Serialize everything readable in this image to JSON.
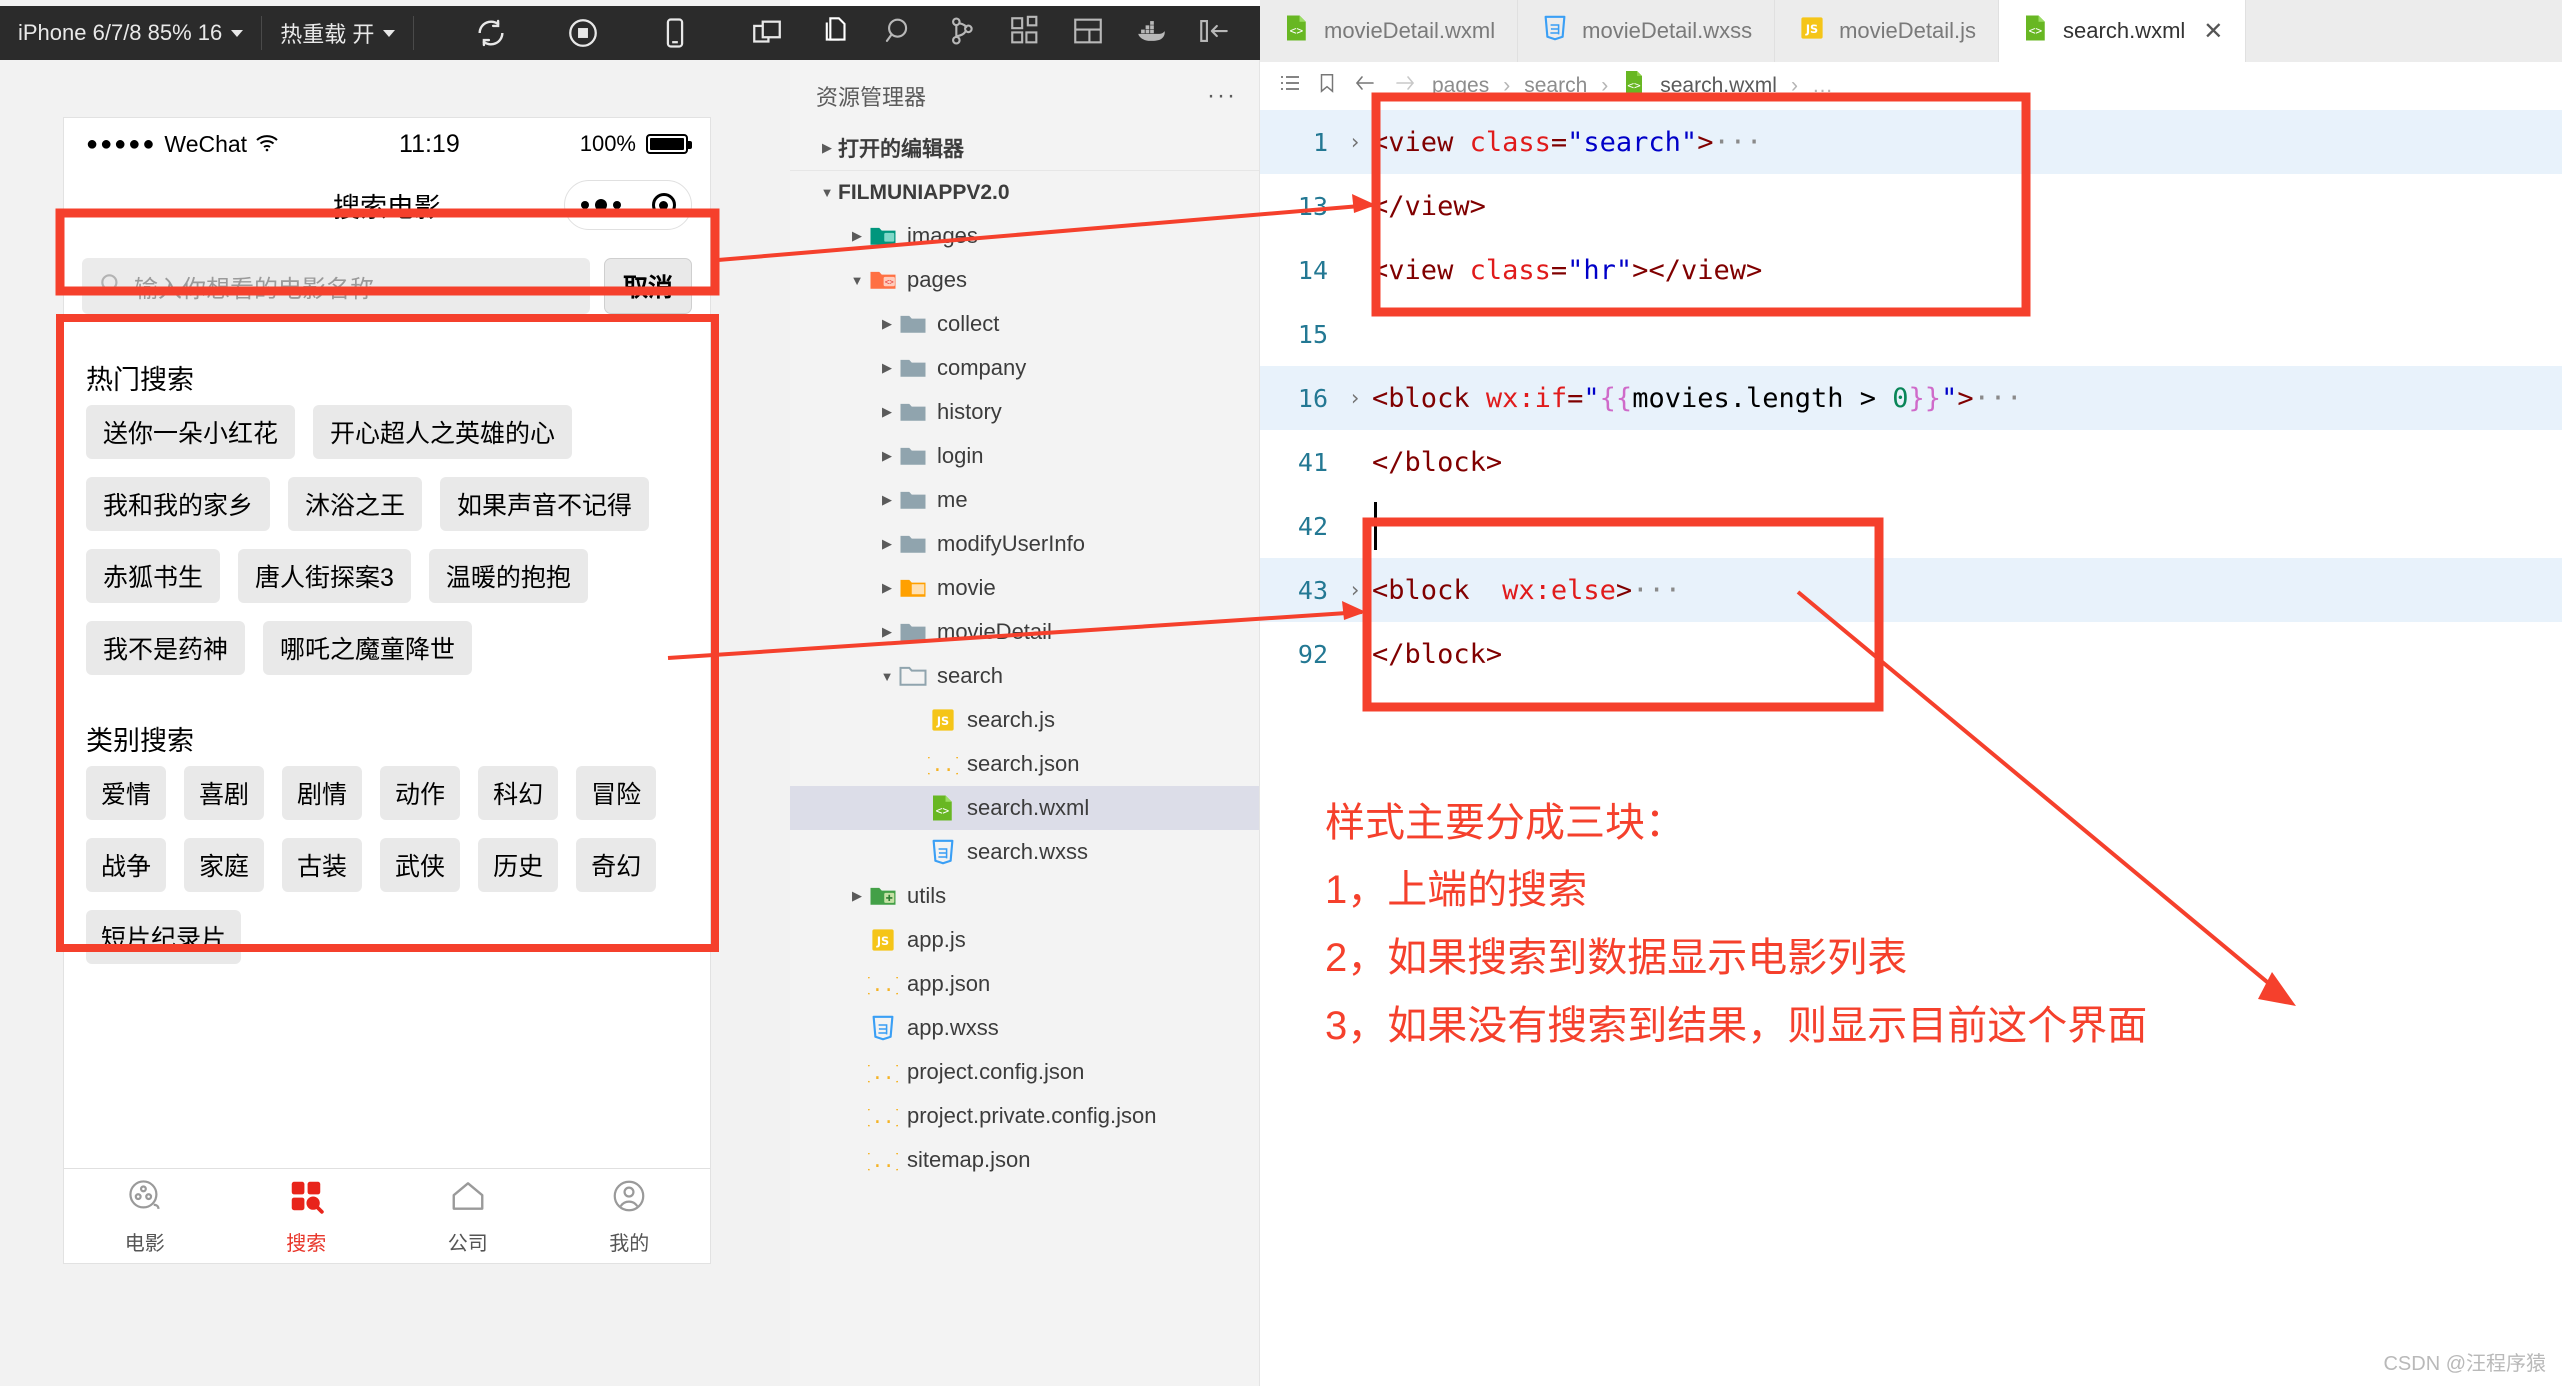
{
  "simulator": {
    "device_select": "iPhone 6/7/8 85% 16",
    "hotreload_select": "热重载 开",
    "toolbar_icons": [
      "refresh-icon",
      "stop-record-icon",
      "phone-icon",
      "multi-window-icon"
    ],
    "phone": {
      "status_bar": {
        "carrier": "WeChat",
        "signal": "●●●●●",
        "time": "11:19",
        "battery_pct": "100%"
      },
      "nav_title": "搜索电影",
      "search": {
        "placeholder": "输入你想看的电影名称",
        "value": "",
        "cancel_label": "取消"
      },
      "hot_section_title": "热门搜索",
      "hot_tags": [
        [
          "送你一朵小红花",
          "开心超人之英雄的心"
        ],
        [
          "我和我的家乡",
          "沐浴之王",
          "如果声音不记得"
        ],
        [
          "赤狐书生",
          "唐人街探案3",
          "温暖的抱抱"
        ],
        [
          "我不是药神",
          "哪吒之魔童降世"
        ]
      ],
      "category_section_title": "类别搜索",
      "category_tags": [
        [
          "爱情",
          "喜剧",
          "剧情",
          "动作",
          "科幻",
          "冒险"
        ],
        [
          "战争",
          "家庭",
          "古装",
          "武侠",
          "历史",
          "奇幻"
        ],
        [
          "短片纪录片"
        ]
      ],
      "tabbar": [
        {
          "label": "电影",
          "icon": "film-reel-icon",
          "active": false
        },
        {
          "label": "搜索",
          "icon": "search-grid-icon",
          "active": true
        },
        {
          "label": "公司",
          "icon": "home-icon",
          "active": false
        },
        {
          "label": "我的",
          "icon": "user-icon",
          "active": false
        }
      ]
    }
  },
  "ide_sidebar": {
    "icons": [
      "files-icon",
      "search-icon",
      "source-control-icon",
      "extensions-icon",
      "layout-icon",
      "docker-icon",
      "collapse-panel-icon"
    ]
  },
  "explorer": {
    "title": "资源管理器",
    "more_label": "···",
    "open_editors_label": "打开的编辑器",
    "project_label": "FILMUNIAPPV2.0",
    "tree": [
      {
        "label": "images",
        "type": "folder",
        "icon": "folder-images-icon",
        "depth": 1,
        "expanded": false,
        "selected": false
      },
      {
        "label": "pages",
        "type": "folder",
        "icon": "folder-pages-icon",
        "depth": 1,
        "expanded": true,
        "selected": false
      },
      {
        "label": "collect",
        "type": "folder",
        "icon": "folder-icon",
        "depth": 2,
        "expanded": false,
        "selected": false
      },
      {
        "label": "company",
        "type": "folder",
        "icon": "folder-icon",
        "depth": 2,
        "expanded": false,
        "selected": false
      },
      {
        "label": "history",
        "type": "folder",
        "icon": "folder-icon",
        "depth": 2,
        "expanded": false,
        "selected": false
      },
      {
        "label": "login",
        "type": "folder",
        "icon": "folder-icon",
        "depth": 2,
        "expanded": false,
        "selected": false
      },
      {
        "label": "me",
        "type": "folder",
        "icon": "folder-icon",
        "depth": 2,
        "expanded": false,
        "selected": false
      },
      {
        "label": "modifyUserInfo",
        "type": "folder",
        "icon": "folder-icon",
        "depth": 2,
        "expanded": false,
        "selected": false
      },
      {
        "label": "movie",
        "type": "folder",
        "icon": "folder-movie-icon",
        "depth": 2,
        "expanded": false,
        "selected": false
      },
      {
        "label": "movieDetail",
        "type": "folder",
        "icon": "folder-icon",
        "depth": 2,
        "expanded": false,
        "selected": false
      },
      {
        "label": "search",
        "type": "folder",
        "icon": "folder-open-icon",
        "depth": 2,
        "expanded": true,
        "selected": false
      },
      {
        "label": "search.js",
        "type": "file",
        "icon": "js-file-icon",
        "depth": 3,
        "selected": false
      },
      {
        "label": "search.json",
        "type": "file",
        "icon": "json-file-icon",
        "depth": 3,
        "selected": false
      },
      {
        "label": "search.wxml",
        "type": "file",
        "icon": "wxml-file-icon",
        "depth": 3,
        "selected": true
      },
      {
        "label": "search.wxss",
        "type": "file",
        "icon": "wxss-file-icon",
        "depth": 3,
        "selected": false
      },
      {
        "label": "utils",
        "type": "folder",
        "icon": "folder-utils-icon",
        "depth": 1,
        "expanded": false,
        "selected": false
      },
      {
        "label": "app.js",
        "type": "file",
        "icon": "js-file-icon",
        "depth": 1,
        "selected": false
      },
      {
        "label": "app.json",
        "type": "file",
        "icon": "json-file-icon",
        "depth": 1,
        "selected": false
      },
      {
        "label": "app.wxss",
        "type": "file",
        "icon": "wxss-file-icon",
        "depth": 1,
        "selected": false
      },
      {
        "label": "project.config.json",
        "type": "file",
        "icon": "json-file-icon",
        "depth": 1,
        "selected": false
      },
      {
        "label": "project.private.config.json",
        "type": "file",
        "icon": "json-file-icon",
        "depth": 1,
        "selected": false
      },
      {
        "label": "sitemap.json",
        "type": "file",
        "icon": "json-file-icon",
        "depth": 1,
        "selected": false
      }
    ]
  },
  "editor": {
    "tabs": [
      {
        "label": "movieDetail.wxml",
        "icon": "wxml-file-icon",
        "active": false,
        "closable": false
      },
      {
        "label": "movieDetail.wxss",
        "icon": "wxss-file-icon",
        "active": false,
        "closable": false
      },
      {
        "label": "movieDetail.js",
        "icon": "js-file-icon",
        "active": false,
        "closable": false
      },
      {
        "label": "search.wxml",
        "icon": "wxml-file-icon",
        "active": true,
        "closable": true,
        "close_label": "✕"
      }
    ],
    "breadcrumb": {
      "list_icon": "outline-icon",
      "bookmark_icon": "bookmark-icon",
      "back_icon": "arrow-left-icon",
      "forward_icon": "arrow-right-icon",
      "items": [
        "pages",
        "search",
        "search.wxml"
      ],
      "trailing": "…",
      "separator": "›"
    },
    "lines": [
      {
        "num": "1",
        "fold": "›",
        "highlight": true,
        "code": "<view class=\"search\">···"
      },
      {
        "num": "13",
        "fold": "",
        "highlight": false,
        "code": "</view>"
      },
      {
        "num": "14",
        "fold": "",
        "highlight": false,
        "code": "<view class=\"hr\"></view>"
      },
      {
        "num": "15",
        "fold": "",
        "highlight": false,
        "code": ""
      },
      {
        "num": "16",
        "fold": "›",
        "highlight": true,
        "code": "<block wx:if=\"{{movies.length > 0}}\">···"
      },
      {
        "num": "41",
        "fold": "",
        "highlight": false,
        "code": "</block>"
      },
      {
        "num": "42",
        "fold": "",
        "highlight": false,
        "code": ""
      },
      {
        "num": "43",
        "fold": "›",
        "highlight": true,
        "code": "<block  wx:else>···"
      },
      {
        "num": "92",
        "fold": "",
        "highlight": false,
        "code": "</block>"
      }
    ]
  },
  "annotation": {
    "heading": "样式主要分成三块：",
    "items": [
      "1，上端的搜索",
      "2，如果搜索到数据显示电影列表",
      "3，如果没有搜索到结果，则显示目前这个界面"
    ],
    "color": "#f5402c"
  },
  "watermark": "CSDN @汪程序猿"
}
